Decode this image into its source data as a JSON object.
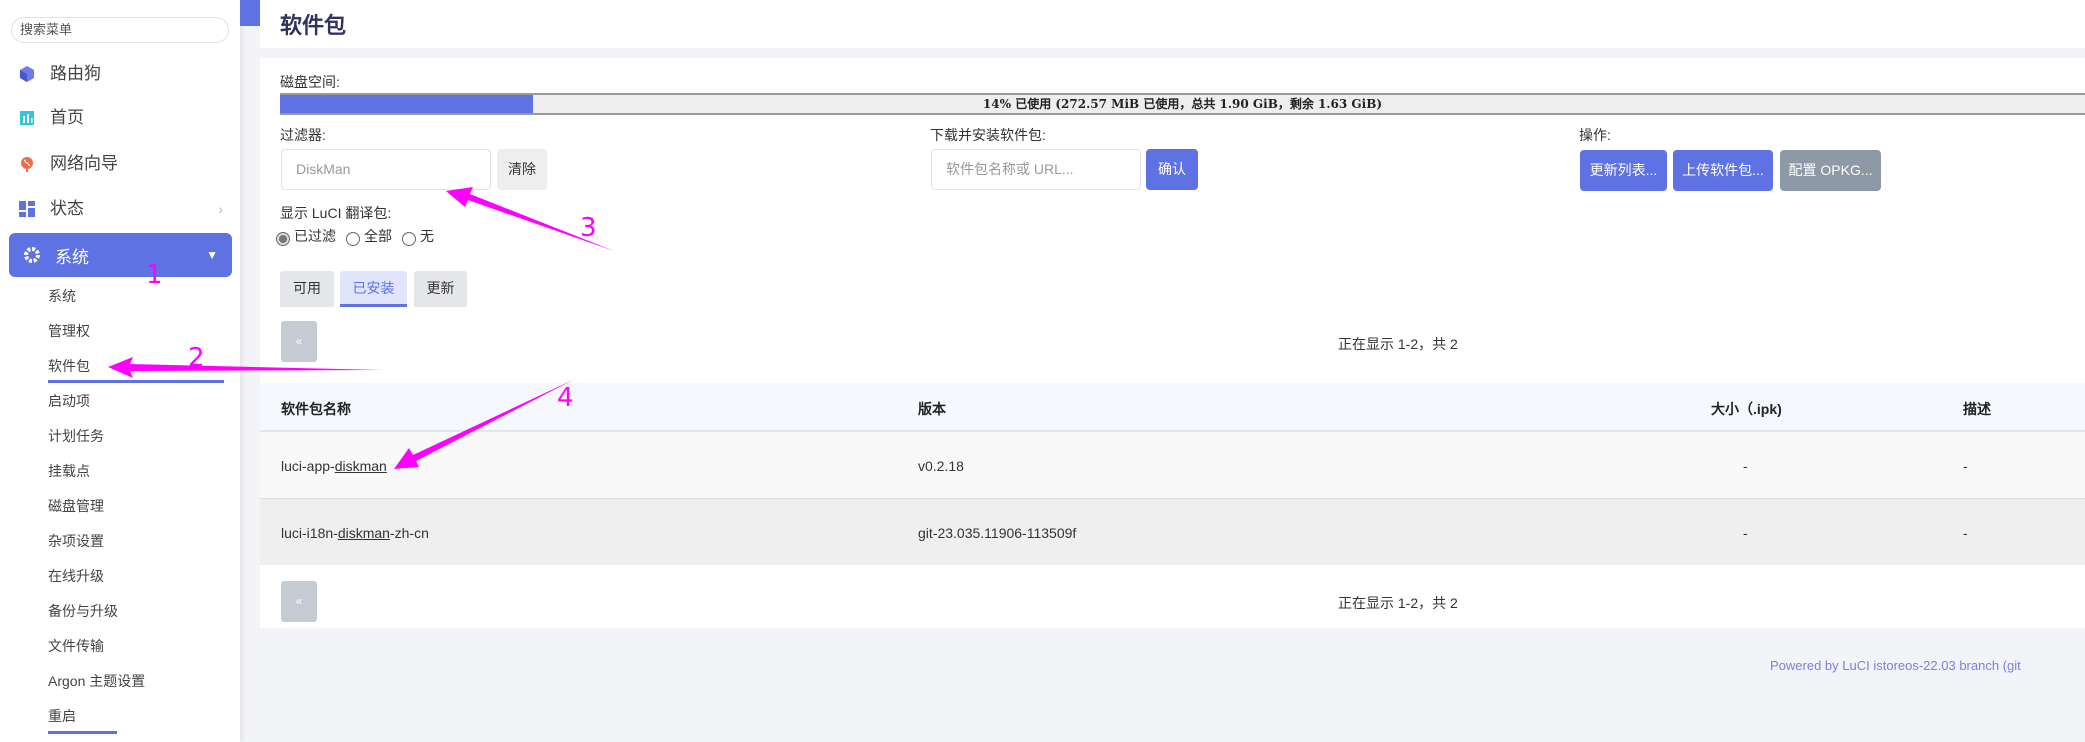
{
  "sidebar": {
    "search_placeholder": "搜索菜单",
    "items": [
      {
        "label": "路由狗",
        "icon": "cube-icon"
      },
      {
        "label": "首页",
        "icon": "dashboard-icon"
      },
      {
        "label": "网络向导",
        "icon": "globe-icon"
      },
      {
        "label": "状态",
        "icon": "grid-icon"
      }
    ],
    "active": {
      "label": "系统",
      "icon": "gear-icon"
    },
    "subitems": [
      "系统",
      "管理权",
      "软件包",
      "启动项",
      "计划任务",
      "挂载点",
      "磁盘管理",
      "杂项设置",
      "在线升级",
      "备份与升级",
      "文件传输",
      "Argon 主题设置",
      "重启"
    ]
  },
  "page": {
    "title": "软件包"
  },
  "disk": {
    "label": "磁盘空间:",
    "percent": 14,
    "text": "14% 已使用 (272.57 MiB 已使用，总共 1.90 GiB，剩余 1.63 GiB)"
  },
  "filter": {
    "label": "过滤器:",
    "value": "DiskMan",
    "clear": "清除"
  },
  "download": {
    "label": "下载并安装软件包:",
    "placeholder": "软件包名称或 URL...",
    "confirm": "确认"
  },
  "actions": {
    "label": "操作:",
    "update": "更新列表...",
    "upload": "上传软件包...",
    "config": "配置 OPKG..."
  },
  "luci": {
    "label": "显示 LuCI 翻译包:",
    "options": [
      "已过滤",
      "全部",
      "无"
    ],
    "selected": "已过滤"
  },
  "tabs": [
    "可用",
    "已安装",
    "更新"
  ],
  "active_tab": "已安装",
  "pager": {
    "prev": "«",
    "status": "正在显示 1-2，共 2"
  },
  "table": {
    "headers": [
      "软件包名称",
      "版本",
      "大小（.ipk)",
      "描述"
    ],
    "rows": [
      {
        "pre": "luci-app-",
        "link": "diskman",
        "post": "",
        "version": "v0.2.18",
        "size": "-",
        "desc": "-"
      },
      {
        "pre": "luci-i18n-",
        "link": "diskman",
        "post": "-zh-cn",
        "version": "git-23.035.11906-113509f",
        "size": "-",
        "desc": "-"
      }
    ]
  },
  "footer": "Powered by LuCI istoreos-22.03 branch (git",
  "annotations": [
    "1",
    "2",
    "3",
    "4"
  ],
  "colors": {
    "primary": "#5e72e4",
    "annotation": "#ff00ff",
    "secondary_button": "#8d99a6"
  }
}
